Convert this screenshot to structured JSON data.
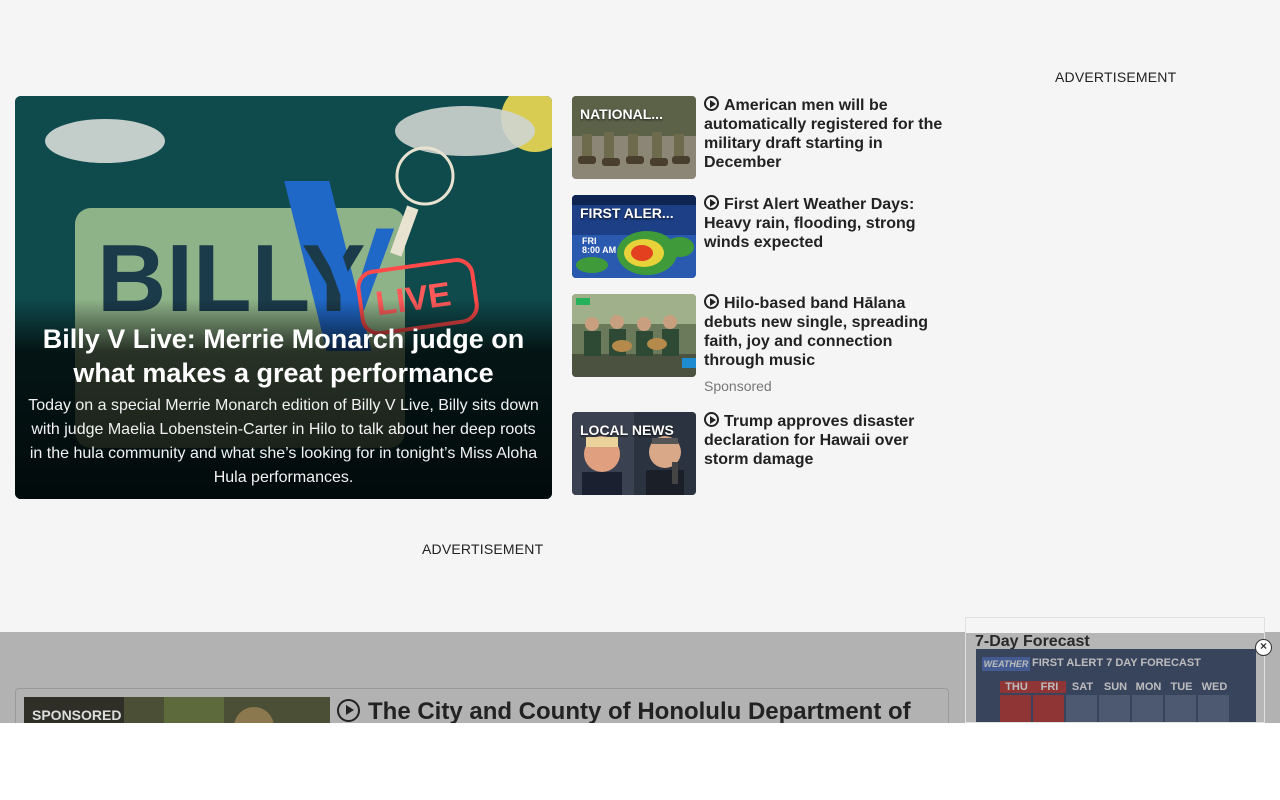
{
  "ads": {
    "right_label": "ADVERTISEMENT",
    "mid_label": "ADVERTISEMENT"
  },
  "hero": {
    "title": "Billy V Live: Merrie Monarch judge on what makes a great performance",
    "description": "Today on a special Merrie Monarch edition of Billy V Live, Billy sits down with judge Maelia Lobenstein-Carter in Hilo to talk about her deep roots in the hula community and what she’s looking for in tonight’s Miss Aloha Hula performances.",
    "art_text": "BILLY",
    "art_v": "V",
    "art_live": "LIVE"
  },
  "stories": [
    {
      "label": "NATIONAL...",
      "title": "American men will be automatically registered for the military draft starting in December",
      "has_video": true,
      "sponsored": ""
    },
    {
      "label": "FIRST ALER...",
      "title": "First Alert Weather Days: Heavy rain, flooding, strong winds expected",
      "has_video": true,
      "sponsored": ""
    },
    {
      "label": "",
      "title": "Hilo-based band Hālana debuts new single, spreading faith, joy and connection through music",
      "has_video": true,
      "sponsored": "Sponsored"
    },
    {
      "label": "LOCAL NEWS",
      "title": "Trump approves disaster declaration for Hawaii over storm damage",
      "has_video": true,
      "sponsored": ""
    }
  ],
  "thumb2_overlay": {
    "day": "FRI",
    "time": "8:00 AM"
  },
  "promo": {
    "label": "SPONSORED",
    "title": "The City and County of Honolulu Department of"
  },
  "forecast": {
    "title": "7-Day Forecast",
    "logo": "WEATHER",
    "headline": "FIRST ALERT 7 DAY FORECAST",
    "days": [
      "THU",
      "FRI",
      "SAT",
      "SUN",
      "MON",
      "TUE",
      "WED"
    ]
  },
  "close_label": "×",
  "colors": {
    "alert_red": "#b62627",
    "page_bg": "#f5f5f5"
  }
}
